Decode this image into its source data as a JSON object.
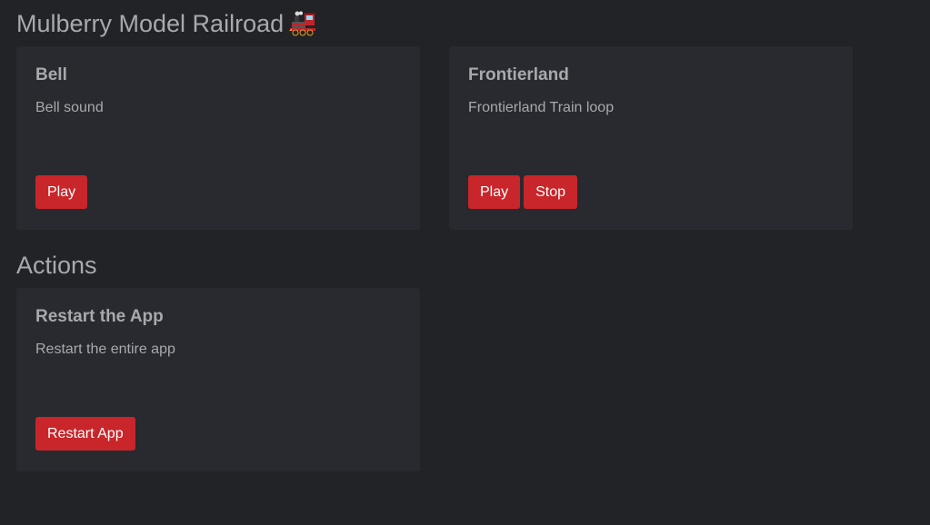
{
  "header": {
    "title": "Mulberry Model Railroad",
    "icon": "locomotive-icon"
  },
  "sounds": [
    {
      "title": "Bell",
      "description": "Bell sound",
      "buttons": [
        "Play"
      ]
    },
    {
      "title": "Frontierland",
      "description": "Frontierland Train loop",
      "buttons": [
        "Play",
        "Stop"
      ]
    }
  ],
  "actions": {
    "heading": "Actions",
    "items": [
      {
        "title": "Restart the App",
        "description": "Restart the entire app",
        "button": "Restart App"
      }
    ]
  },
  "colors": {
    "background": "#212327",
    "card": "#282a2f",
    "text": "#a7a9ad",
    "button": "#c8262a"
  }
}
